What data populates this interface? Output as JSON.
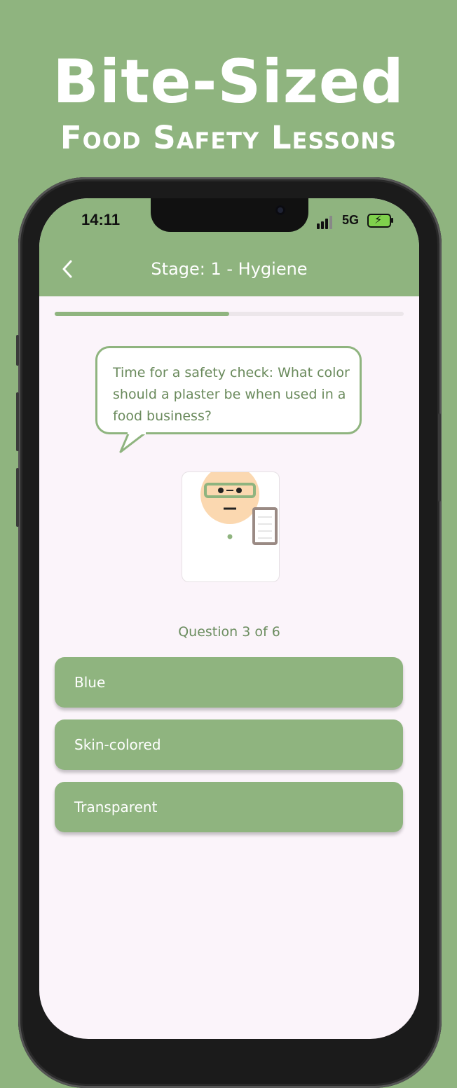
{
  "banner": {
    "title": "Bite-Sized",
    "subtitle": "Food Safety Lessons"
  },
  "status_bar": {
    "time": "14:11",
    "network": "5G",
    "signal_icon": "signal-bars-icon",
    "battery_icon": "battery-charging-icon"
  },
  "header": {
    "title": "Stage: 1 - Hygiene",
    "back_icon": "chevron-left-icon"
  },
  "progress": {
    "value": 0.5
  },
  "speech_bubble": {
    "text": "Time for a safety check: What color should a plaster be when used in a food business?"
  },
  "mascot": {
    "icon": "inspector-character-icon"
  },
  "question_counter": "Question 3 of 6",
  "answers": [
    {
      "label": "Blue"
    },
    {
      "label": "Skin-colored"
    },
    {
      "label": "Transparent"
    }
  ],
  "colors": {
    "background": "#8fb47f",
    "screen": "#fbf4fa",
    "accent": "#8fb47f",
    "text_accent": "#6c8d60",
    "skin": "#fbd8b0",
    "clipboard": "#9a8a84"
  }
}
